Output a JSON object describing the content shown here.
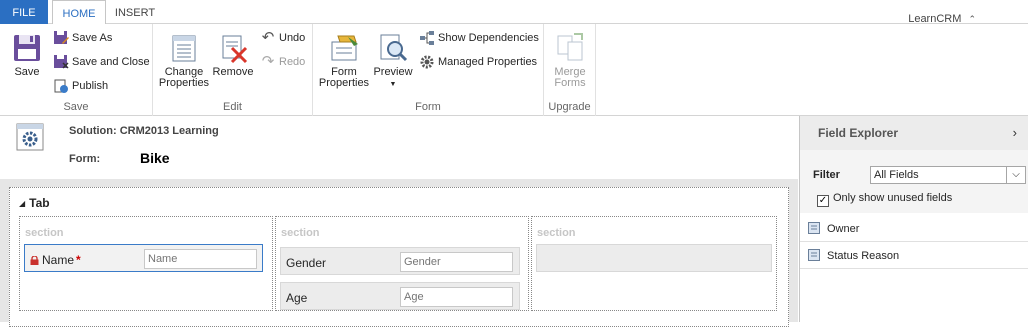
{
  "tabs": {
    "file": "FILE",
    "home": "HOME",
    "insert": "INSERT"
  },
  "user": {
    "org": "LearnCRM"
  },
  "ribbon": {
    "save_group": {
      "label": "Save",
      "save": "Save",
      "save_as": "Save As",
      "save_and_close": "Save and Close",
      "publish": "Publish"
    },
    "edit_group": {
      "label": "Edit",
      "change_properties_1": "Change",
      "change_properties_2": "Properties",
      "remove": "Remove",
      "undo": "Undo",
      "redo": "Redo"
    },
    "form_group": {
      "label": "Form",
      "form_properties_1": "Form",
      "form_properties_2": "Properties",
      "preview": "Preview",
      "show_dependencies": "Show Dependencies",
      "managed_properties": "Managed Properties"
    },
    "upgrade_group": {
      "label": "Upgrade",
      "merge_forms_1": "Merge",
      "merge_forms_2": "Forms"
    }
  },
  "header": {
    "solution": "Solution: CRM2013 Learning",
    "form_label": "Form:",
    "form_name": "Bike"
  },
  "canvas": {
    "tab_title": "Tab",
    "sections": [
      {
        "label": "section",
        "fields": [
          {
            "label": "Name",
            "placeholder": "Name",
            "required": "*"
          }
        ]
      },
      {
        "label": "section",
        "fields": [
          {
            "label": "Gender",
            "placeholder": "Gender"
          },
          {
            "label": "Age",
            "placeholder": "Age"
          }
        ]
      },
      {
        "label": "section",
        "fields": []
      }
    ]
  },
  "explorer": {
    "title": "Field Explorer",
    "filter_label": "Filter",
    "filter_value": "All Fields",
    "only_unused": "Only show unused fields",
    "only_unused_checked": true,
    "items": [
      "Owner",
      "Status Reason"
    ]
  },
  "colors": {
    "file_tab": "#2b6fc2",
    "selected_field_border": "#3a7bc8",
    "required": "#cc0000",
    "canvas_bg": "#e6e6e6"
  }
}
